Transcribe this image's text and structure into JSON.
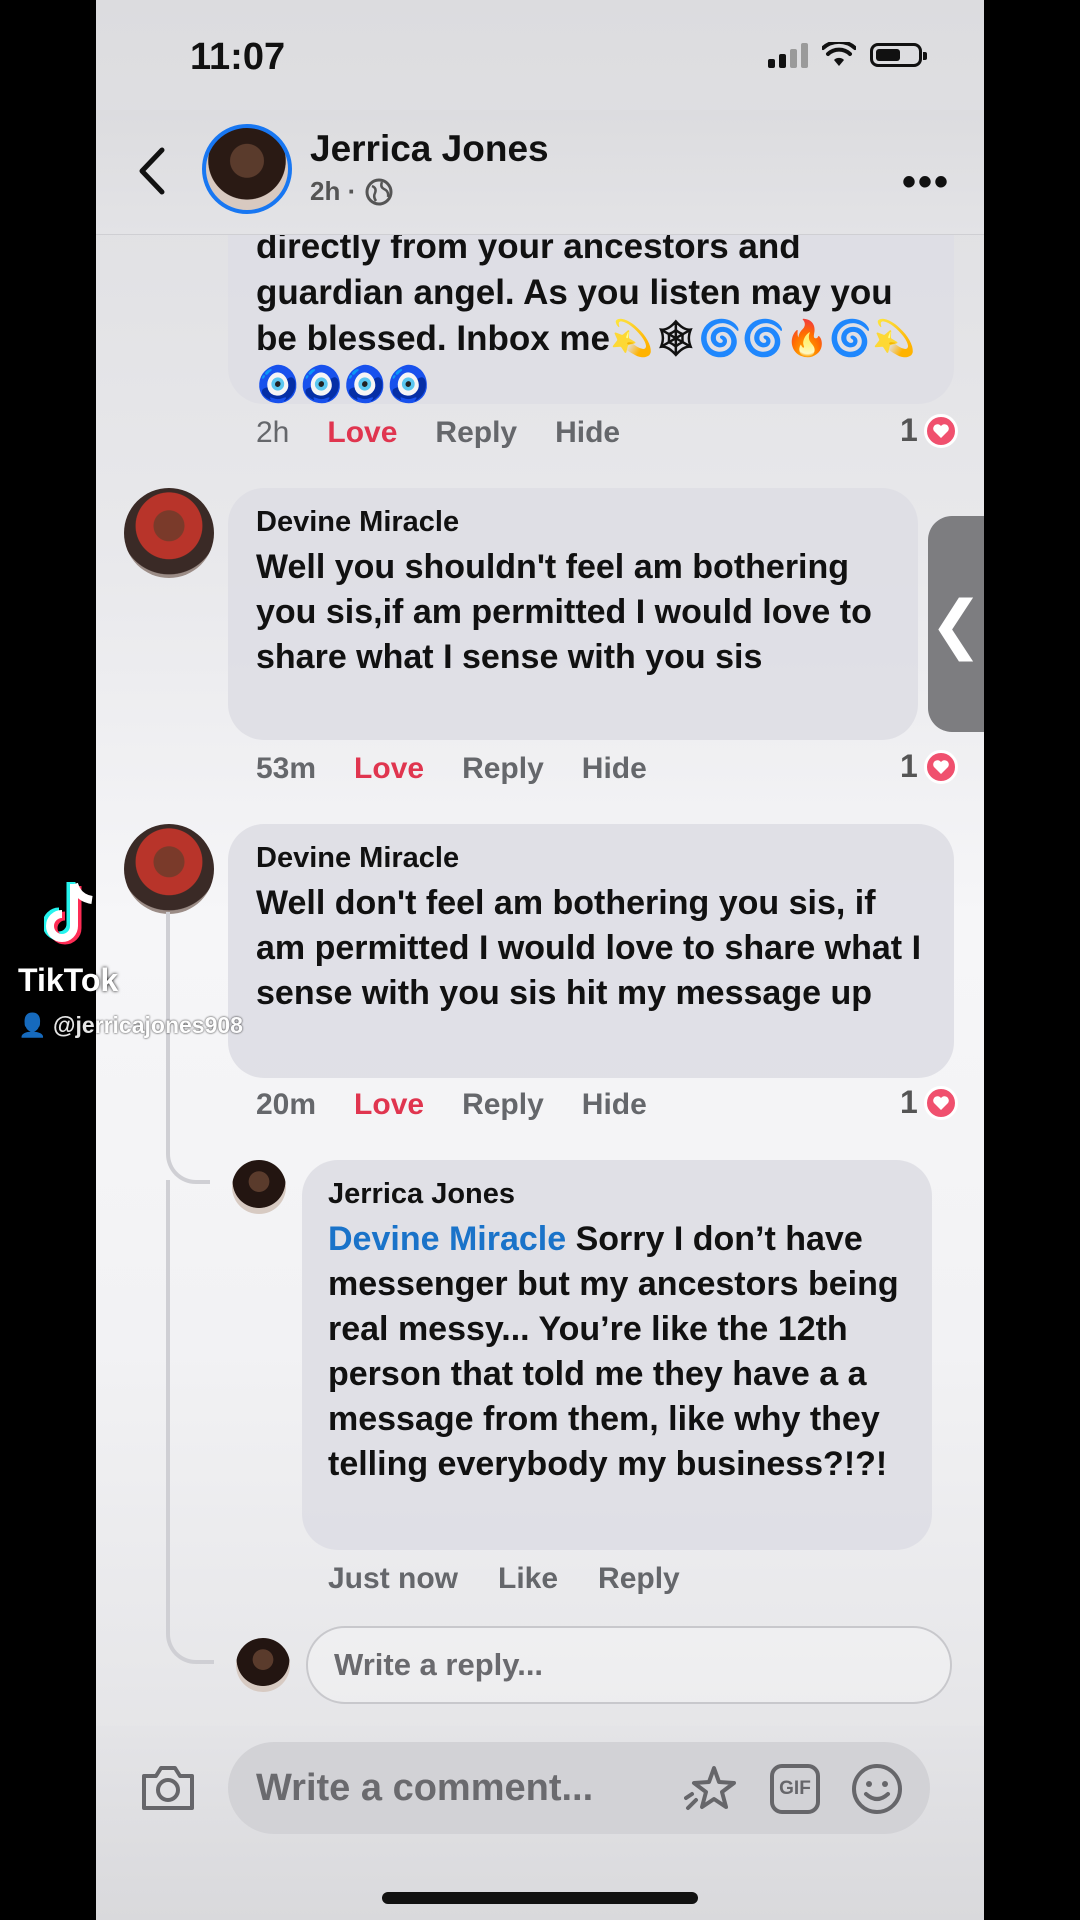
{
  "status_bar": {
    "time": "11:07"
  },
  "header": {
    "name": "Jerrica Jones",
    "meta": "2h ·",
    "more": "•••"
  },
  "comments": [
    {
      "author": "",
      "text": "directly from your ancestors and guardian angel. As you listen may you be blessed. Inbox me💫🕸🌀🌀🔥🌀💫🧿🧿🧿🧿",
      "time": "2h",
      "actions": [
        "Love",
        "Reply",
        "Hide"
      ],
      "reaction_count": "1"
    },
    {
      "author": "Devine Miracle",
      "text": "Well you shouldn't feel am bothering you sis,if am permitted I would love to share what I sense with you sis",
      "time": "53m",
      "actions": [
        "Love",
        "Reply",
        "Hide"
      ],
      "reaction_count": "1"
    },
    {
      "author": "Devine Miracle",
      "text": "Well don't feel am bothering you sis, if am permitted I would love to share what I sense with you sis hit my message up",
      "time": "20m",
      "actions": [
        "Love",
        "Reply",
        "Hide"
      ],
      "reaction_count": "1"
    }
  ],
  "reply": {
    "author": "Jerrica Jones",
    "mention": "Devine Miracle",
    "text": " Sorry I don’t have messenger but my ancestors being real messy... You’re like the 12th person that told me they have a a message from them, like why they telling everybody my business?!?!",
    "time": "Just now",
    "actions": [
      "Like",
      "Reply"
    ]
  },
  "reply_input": {
    "placeholder": "Write a reply..."
  },
  "comment_bar": {
    "placeholder": "Write a comment...",
    "gif_label": "GIF"
  },
  "side_handle": {
    "glyph": "❮"
  },
  "tiktok": {
    "wordmark": "TikTok",
    "handle": "@jerricajones908"
  },
  "colors": {
    "accent": "#1877f2",
    "love": "#e0354f",
    "mention": "#1a73c9"
  },
  "icons": [
    "back-icon",
    "globe-icon",
    "more-icon",
    "heart-icon",
    "camera-icon",
    "sticker-icon",
    "gif-icon",
    "smile-icon",
    "tiktok-logo-icon"
  ]
}
